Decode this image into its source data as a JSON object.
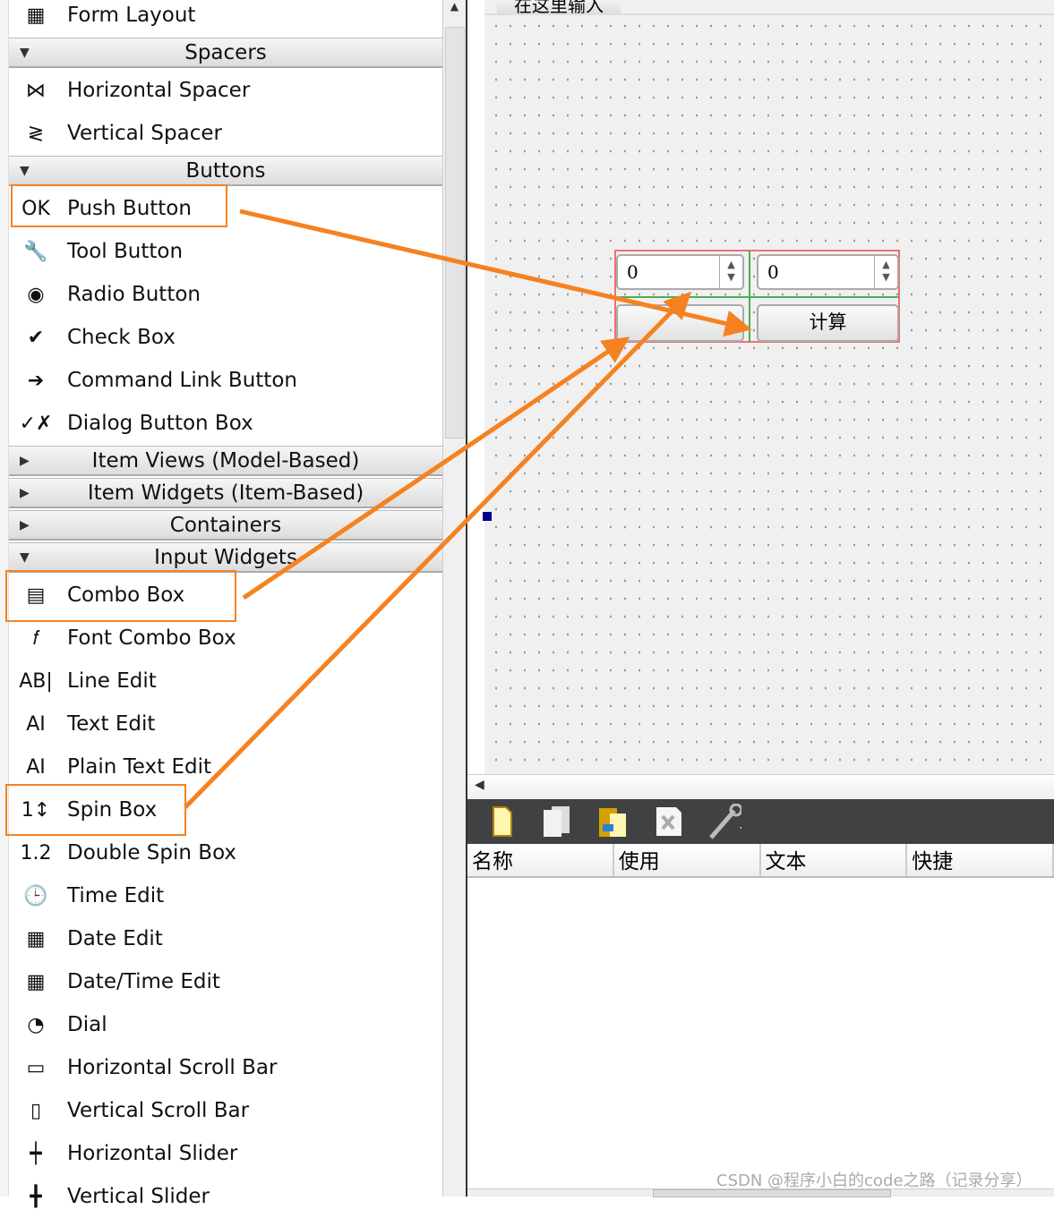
{
  "widget_box": {
    "items": [
      {
        "type": "item",
        "label": "Form Layout",
        "icon": "form-layout-icon",
        "glyph": "▦"
      },
      {
        "type": "header",
        "label": "Spacers",
        "expanded": true
      },
      {
        "type": "item",
        "label": "Horizontal Spacer",
        "icon": "horizontal-spacer-icon",
        "glyph": "⋈"
      },
      {
        "type": "item",
        "label": "Vertical Spacer",
        "icon": "vertical-spacer-icon",
        "glyph": "≷"
      },
      {
        "type": "header",
        "label": "Buttons",
        "expanded": true
      },
      {
        "type": "item",
        "label": "Push Button",
        "icon": "push-button-icon",
        "glyph": "OK"
      },
      {
        "type": "item",
        "label": "Tool Button",
        "icon": "tool-button-icon",
        "glyph": "🔧"
      },
      {
        "type": "item",
        "label": "Radio Button",
        "icon": "radio-button-icon",
        "glyph": "◉"
      },
      {
        "type": "item",
        "label": "Check Box",
        "icon": "check-box-icon",
        "glyph": "✔"
      },
      {
        "type": "item",
        "label": "Command Link Button",
        "icon": "command-link-icon",
        "glyph": "➔"
      },
      {
        "type": "item",
        "label": "Dialog Button Box",
        "icon": "dialog-button-box-icon",
        "glyph": "✓✗"
      },
      {
        "type": "header",
        "label": "Item Views (Model-Based)",
        "expanded": false
      },
      {
        "type": "header",
        "label": "Item Widgets (Item-Based)",
        "expanded": false
      },
      {
        "type": "header",
        "label": "Containers",
        "expanded": false
      },
      {
        "type": "header",
        "label": "Input Widgets",
        "expanded": true
      },
      {
        "type": "item",
        "label": "Combo Box",
        "icon": "combo-box-icon",
        "glyph": "▤"
      },
      {
        "type": "item",
        "label": "Font Combo Box",
        "icon": "font-combo-box-icon",
        "glyph": "𝑓"
      },
      {
        "type": "item",
        "label": "Line Edit",
        "icon": "line-edit-icon",
        "glyph": "AB|"
      },
      {
        "type": "item",
        "label": "Text Edit",
        "icon": "text-edit-icon",
        "glyph": "AI"
      },
      {
        "type": "item",
        "label": "Plain Text Edit",
        "icon": "plain-text-edit-icon",
        "glyph": "AI"
      },
      {
        "type": "item",
        "label": "Spin Box",
        "icon": "spin-box-icon",
        "glyph": "1↕"
      },
      {
        "type": "item",
        "label": "Double Spin Box",
        "icon": "double-spin-box-icon",
        "glyph": "1.2"
      },
      {
        "type": "item",
        "label": "Time Edit",
        "icon": "time-edit-icon",
        "glyph": "🕒"
      },
      {
        "type": "item",
        "label": "Date Edit",
        "icon": "date-edit-icon",
        "glyph": "▦"
      },
      {
        "type": "item",
        "label": "Date/Time Edit",
        "icon": "datetime-edit-icon",
        "glyph": "▦"
      },
      {
        "type": "item",
        "label": "Dial",
        "icon": "dial-icon",
        "glyph": "◔"
      },
      {
        "type": "item",
        "label": "Horizontal Scroll Bar",
        "icon": "horizontal-scroll-bar-icon",
        "glyph": "▭"
      },
      {
        "type": "item",
        "label": "Vertical Scroll Bar",
        "icon": "vertical-scroll-bar-icon",
        "glyph": "▯"
      },
      {
        "type": "item",
        "label": "Horizontal Slider",
        "icon": "horizontal-slider-icon",
        "glyph": "┿"
      },
      {
        "type": "item",
        "label": "Vertical Slider",
        "icon": "vertical-slider-icon",
        "glyph": "╋"
      }
    ]
  },
  "form": {
    "tab_label": "在这里输入",
    "spin1_value": "0",
    "spin2_value": "0",
    "combo_value": "",
    "button_label": "计算"
  },
  "action_editor": {
    "toolbar": [
      "new-action-icon",
      "copy-action-icon",
      "paste-action-icon",
      "delete-action-icon",
      "configure-icon"
    ],
    "columns": [
      "名称",
      "使用",
      "文本",
      "快捷"
    ]
  },
  "watermark": "CSDN @程序小白的code之路（记录分享）",
  "colors": {
    "highlight": "#f58220",
    "layout_frame": "#f07070",
    "layout_grid": "#4caf50",
    "toolbar_bg": "#404142"
  }
}
